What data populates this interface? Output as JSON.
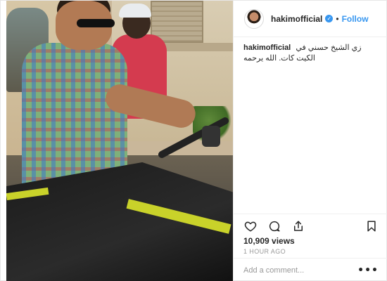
{
  "post": {
    "username": "hakimofficial",
    "follow_label": "Follow",
    "separator": "•",
    "verified_glyph": "✓"
  },
  "caption": {
    "username": "hakimofficial",
    "text": "زي الشيخ حسني في الكيت كات. الله يرحمه"
  },
  "actions": {
    "like_icon": "heart-icon",
    "comment_icon": "comment-icon",
    "share_icon": "share-icon",
    "save_icon": "bookmark-icon"
  },
  "stats": {
    "views": "10,909 views",
    "time": "1 HOUR AGO"
  },
  "comment": {
    "placeholder": "Add a comment...",
    "more_glyph": "•••"
  },
  "colors": {
    "accent": "#3897f0",
    "text": "#262626",
    "muted": "#999999",
    "border": "#efefef"
  }
}
